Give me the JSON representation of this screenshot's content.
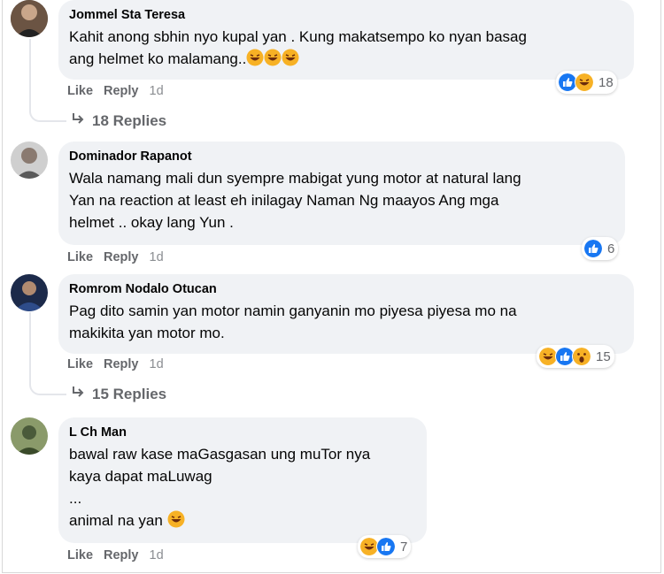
{
  "comments": [
    {
      "author": "Jommel Sta Teresa",
      "text": "Kahit anong sbhin nyo kupal yan . Kung makatsempo ko nyan basag\nang helmet ko malamang..",
      "emoji_suffix": "laugh-laugh-laugh",
      "like_label": "Like",
      "reply_label": "Reply",
      "time": "1d",
      "reactions": [
        "like",
        "haha"
      ],
      "reaction_count": "18",
      "replies_label": "18 Replies"
    },
    {
      "author": "Dominador Rapanot",
      "text": "Wala namang mali dun syempre mabigat yung motor at natural lang\nYan na reaction at least eh inilagay Naman Ng maayos Ang mga\nhelmet .. okay lang Yun .",
      "like_label": "Like",
      "reply_label": "Reply",
      "time": "1d",
      "reactions": [
        "like"
      ],
      "reaction_count": "6"
    },
    {
      "author": "Romrom Nodalo Otucan",
      "text": "Pag dito samin yan motor namin ganyanin mo piyesa piyesa mo na\nmakikita yan motor mo.",
      "like_label": "Like",
      "reply_label": "Reply",
      "time": "1d",
      "reactions": [
        "haha",
        "like",
        "wow"
      ],
      "reaction_count": "15",
      "replies_label": "15 Replies"
    },
    {
      "author": "L Ch Man",
      "text": "bawal raw kase maGasgasan ung muTor nya\nkaya dapat maLuwag\n...\nanimal na yan",
      "emoji_suffix": "laugh",
      "like_label": "Like",
      "reply_label": "Reply",
      "time": "1d",
      "reactions": [
        "haha",
        "like"
      ],
      "reaction_count": "7"
    }
  ],
  "colors": {
    "bubble": "#f0f2f5",
    "like_blue": "#1877f2",
    "haha_yellow": "#f7b125",
    "meta_gray": "#65676b"
  }
}
